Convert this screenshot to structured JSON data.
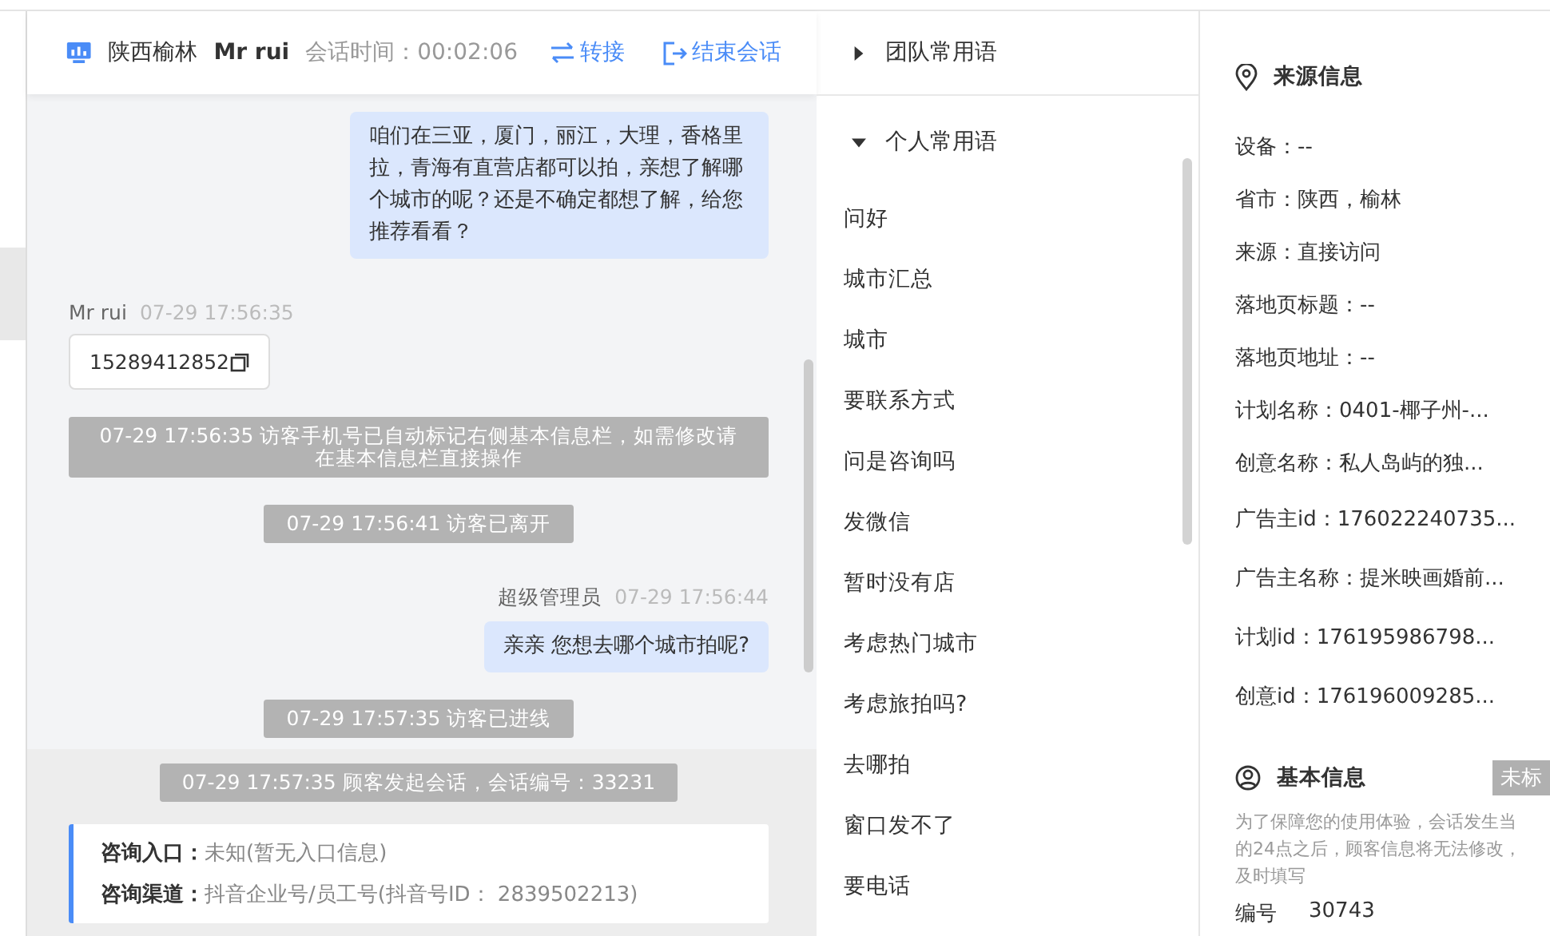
{
  "chat": {
    "header": {
      "location": "陕西榆林",
      "visitor": "Mr rui",
      "duration_label": "会话时间：",
      "duration": "00:02:06",
      "actions": [
        "转接",
        "结束会话"
      ]
    },
    "messages": [
      {
        "kind": "agent",
        "text": "咱们在三亚，厦门，丽江，大理，香格里拉，青海有直营店都可以拍，亲想了解哪个城市的呢？还是不确定都想了解，给您推荐看看？"
      },
      {
        "kind": "visitor",
        "sender": "Mr rui",
        "time": "07-29 17:56:35",
        "text": "15289412852"
      },
      {
        "kind": "system",
        "text": "07-29 17:56:35 访客手机号已自动标记右侧基本信息栏，如需修改请在基本信息栏直接操作"
      },
      {
        "kind": "system",
        "text": "07-29 17:56:41 访客已离开"
      },
      {
        "kind": "agent",
        "sender": "超级管理员",
        "time": "07-29 17:56:44",
        "text": "亲亲 您想去哪个城市拍呢?"
      },
      {
        "kind": "system",
        "text": "07-29 17:57:35 访客已进线"
      }
    ],
    "session": {
      "notice": "07-29 17:57:35 顾客发起会话，会话编号：33231",
      "entries": [
        {
          "label": "咨询入口：",
          "value": "未知(暂无入口信息)"
        },
        {
          "label": "咨询渠道：",
          "value": "抖音企业号/员工号(抖音号ID： 2839502213)"
        }
      ]
    }
  },
  "phrases": {
    "groups": [
      {
        "title": "团队常用语",
        "expanded": false
      },
      {
        "title": "个人常用语",
        "expanded": true,
        "items": [
          "问好",
          "城市汇总",
          "城市",
          "要联系方式",
          "问是咨询吗",
          "发微信",
          "暂时没有店",
          "考虑热门城市",
          "考虑旅拍吗?",
          "去哪拍",
          "窗口发不了",
          "要电话"
        ]
      }
    ]
  },
  "source_info": {
    "title": "来源信息",
    "rows": [
      "设备：--",
      "省市：陕西，榆林",
      "来源：直接访问",
      "落地页标题：--",
      "落地页地址：--",
      "计划名称：0401-椰子州-...",
      "创意名称：私人岛屿的独...",
      "广告主id：176022240735...",
      "广告主名称：提米映画婚前...",
      "计划id：176195986798...",
      "创意id：176196009285..."
    ]
  },
  "basic_info": {
    "title": "基本信息",
    "tag": "未标",
    "notice": [
      "为了保障您的使用体验，会话发生当",
      "的24点之后，顾客信息将无法修改，",
      "及时填写"
    ],
    "fields": [
      {
        "label": "编号",
        "value": "30743"
      }
    ]
  }
}
